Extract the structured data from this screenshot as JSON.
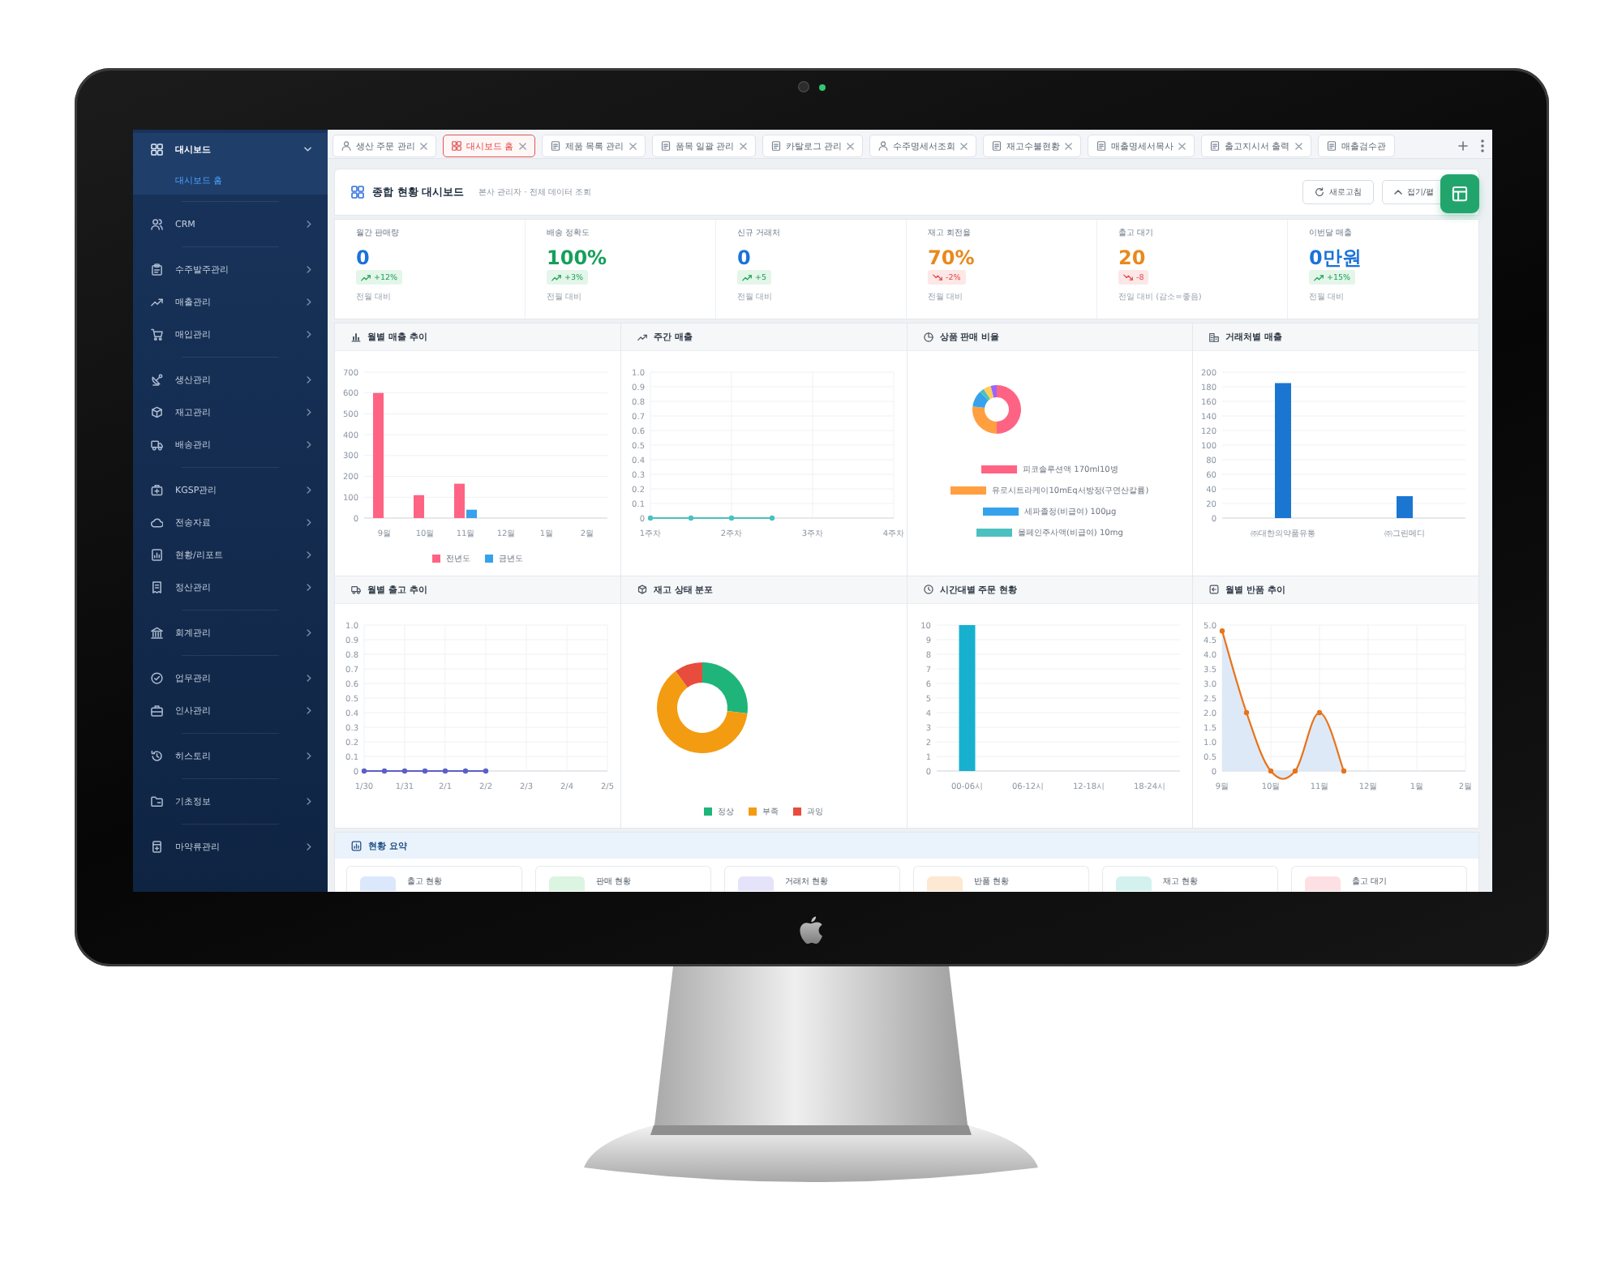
{
  "sidebar": {
    "groups": [
      {
        "items": [
          {
            "label": "대시보드",
            "expanded": true,
            "children": [
              {
                "label": "대시보드 홈",
                "selected": true
              }
            ]
          }
        ]
      },
      {
        "items": [
          {
            "label": "CRM",
            "expanded": false
          }
        ]
      },
      {
        "items": [
          {
            "label": "수주발주관리",
            "expanded": false
          },
          {
            "label": "매출관리",
            "expanded": false
          },
          {
            "label": "매입관리",
            "expanded": false
          }
        ]
      },
      {
        "items": [
          {
            "label": "생산관리",
            "expanded": false
          },
          {
            "label": "재고관리",
            "expanded": false
          },
          {
            "label": "배송관리",
            "expanded": false
          }
        ]
      },
      {
        "items": [
          {
            "label": "KGSP관리",
            "expanded": false
          },
          {
            "label": "전송자료",
            "expanded": false
          },
          {
            "label": "현황/리포트",
            "expanded": false
          },
          {
            "label": "정산관리",
            "expanded": false
          }
        ]
      },
      {
        "items": [
          {
            "label": "회계관리",
            "expanded": false
          }
        ]
      },
      {
        "items": [
          {
            "label": "업무관리",
            "expanded": false
          },
          {
            "label": "인사관리",
            "expanded": false
          }
        ]
      },
      {
        "items": [
          {
            "label": "히스토리",
            "expanded": false
          }
        ]
      },
      {
        "items": [
          {
            "label": "기초정보",
            "expanded": false
          }
        ]
      },
      {
        "items": [
          {
            "label": "마약류관리",
            "expanded": false
          }
        ]
      }
    ]
  },
  "tabs": [
    {
      "label": "생산 주문 관리",
      "selected": false,
      "closable": true
    },
    {
      "label": "대시보드 홈",
      "selected": true,
      "closable": true
    },
    {
      "label": "제품 목록 관리",
      "selected": false,
      "closable": true
    },
    {
      "label": "품목 일괄 관리",
      "selected": false,
      "closable": true
    },
    {
      "label": "카탈로그 관리",
      "selected": false,
      "closable": true
    },
    {
      "label": "수주명세서조회",
      "selected": false,
      "closable": true
    },
    {
      "label": "재고수불현황",
      "selected": false,
      "closable": true
    },
    {
      "label": "매출명세서목사",
      "selected": false,
      "closable": true
    },
    {
      "label": "출고지시서 출력",
      "selected": false,
      "closable": true
    },
    {
      "label": "매출검수관",
      "selected": false,
      "closable": false
    }
  ],
  "header": {
    "title": "종합 현황 대시보드",
    "subtitle": "본사 관리자 · 전체 데이터 조회",
    "buttons": [
      {
        "label": "새로고침",
        "kind": "refresh"
      },
      {
        "label": "접기/펼",
        "kind": "collapse"
      }
    ]
  },
  "kpis": [
    {
      "label": "월간 판매량",
      "value": "0",
      "color": "#1a73d9",
      "change": "+12%",
      "kind": "increase",
      "note": "전월 대비"
    },
    {
      "label": "배송 정확도",
      "value": "100%",
      "color": "#15a05c",
      "change": "+3%",
      "kind": "increase",
      "note": "전월 대비"
    },
    {
      "label": "신규 거래처",
      "value": "0",
      "color": "#1a73d9",
      "change": "+5",
      "kind": "increase",
      "note": "전월 대비"
    },
    {
      "label": "재고 회전율",
      "value": "70%",
      "color": "#e8891c",
      "change": "-2%",
      "kind": "decrease",
      "note": "전월 대비"
    },
    {
      "label": "출고 대기",
      "value": "20",
      "color": "#e8891c",
      "change": "-8",
      "kind": "decrease",
      "note": "전일 대비 (감소=좋음)"
    },
    {
      "label": "이번달 매출",
      "value": "0만원",
      "color": "#1a73d9",
      "change": "+15%",
      "kind": "increase",
      "note": "전월 대비"
    }
  ],
  "charts": [
    {
      "title": "월별 매출 추이",
      "kind": "chart",
      "chart_data": {
        "type": "bar",
        "grid": true,
        "categories": [
          "9월",
          "10월",
          "11월",
          "12월",
          "1월",
          "2월"
        ],
        "series": [
          {
            "name": "전년도",
            "color": "#ff6384",
            "values": [
              600,
              110,
              165,
              0,
              0,
              0
            ]
          },
          {
            "name": "금년도",
            "color": "#36a2eb",
            "values": [
              0,
              0,
              40,
              0,
              0,
              0
            ]
          }
        ],
        "ylim": [
          0,
          700
        ],
        "yticks": [
          {
            "value": 0,
            "label": "0"
          },
          100,
          200,
          300,
          400,
          500,
          600,
          700
        ]
      }
    },
    {
      "title": "주간 매출",
      "kind": "chart",
      "chart_data": {
        "type": "line",
        "grid": true,
        "categories": [
          "1주차",
          null,
          "2주차",
          null,
          "3주차",
          null,
          "4주차"
        ],
        "series": [
          {
            "color": "#4bc0c0",
            "marker": true,
            "values": [
              0,
              0,
              0,
              0,
              null,
              null,
              null
            ]
          }
        ],
        "ylim": [
          0,
          1
        ],
        "yticks": [
          {
            "value": 0,
            "label": "0"
          },
          0.1,
          0.2,
          0.3,
          0.4,
          0.5,
          0.6,
          0.7,
          0.8,
          0.9,
          {
            "value": 1,
            "label": "1.0"
          }
        ]
      }
    },
    {
      "title": "상품 판매 비율",
      "kind": "donut",
      "legend": [
        {
          "label": "피코솔루션액 170ml10병",
          "color": "#ff6384"
        },
        {
          "label": "유로시트라케이10mEq서방정(구연산칼륨)",
          "color": "#ff9f40"
        },
        {
          "label": "세파졸정(비급여) 100µg",
          "color": "#36a2eb"
        },
        {
          "label": "몰페인주사액(비급여) 10mg",
          "color": "#4bc0c0"
        }
      ]
    },
    {
      "title": "거래처별 매출",
      "kind": "chart",
      "chart_data": {
        "type": "bar",
        "grid": true,
        "categories": [
          "㈜대한의약품유통",
          "㈜그린메디"
        ],
        "series": [
          {
            "color": "#1b76d2",
            "values": [
              185,
              30
            ]
          }
        ],
        "ylim": [
          0,
          200
        ],
        "yticks": [
          {
            "value": 0,
            "label": "0"
          },
          {
            "value": 20,
            "label": "20"
          },
          40,
          60,
          80,
          100,
          120,
          140,
          160,
          180,
          200
        ]
      }
    },
    {
      "title": "월별 출고 추이",
      "kind": "chart",
      "chart_data": {
        "type": "line",
        "grid": true,
        "categories": [
          "1/30",
          null,
          "1/31",
          null,
          "2/1",
          null,
          "2/2",
          null,
          "2/3",
          null,
          "2/4",
          null,
          "2/5"
        ],
        "series": [
          {
            "color": "#5b5fc7",
            "marker": true,
            "values": [
              0,
              0,
              0,
              0,
              0,
              0,
              0,
              null,
              null,
              null,
              null,
              null,
              null
            ]
          }
        ],
        "ylim": [
          0,
          1
        ],
        "yticks": [
          {
            "value": 0,
            "label": "0"
          },
          0.1,
          0.2,
          0.3,
          0.4,
          0.5,
          0.6,
          0.7,
          0.8,
          0.9,
          {
            "value": 1,
            "label": "1.0"
          }
        ]
      }
    },
    {
      "title": "재고 상태 분포",
      "kind": "donut",
      "legend": [
        {
          "label": "정상",
          "color": "#1fb57a"
        },
        {
          "label": "부족",
          "color": "#f39c12"
        },
        {
          "label": "과잉",
          "color": "#e74c3c"
        }
      ]
    },
    {
      "title": "시간대별 주문 현황",
      "kind": "chart",
      "chart_data": {
        "type": "bar",
        "grid": true,
        "categories": [
          "00-06시",
          "06-12시",
          "12-18시",
          "18-24시"
        ],
        "series": [
          {
            "color": "#17b1cf",
            "values": [
              10,
              0,
              0,
              0
            ]
          }
        ],
        "ylim": [
          0,
          10
        ],
        "yticks": [
          {
            "value": 0,
            "label": "0"
          },
          1,
          2,
          3,
          4,
          5,
          6,
          7,
          8,
          9,
          10
        ]
      }
    },
    {
      "title": "월별 반품 추이",
      "kind": "chart",
      "chart_data": {
        "type": "area",
        "grid": true,
        "categories": [
          "9월",
          null,
          "10월",
          null,
          "11월",
          null,
          "12월",
          null,
          "1월",
          null,
          "2월"
        ],
        "series": [
          {
            "color": "#e8731a",
            "marker": true,
            "values": [
              4.8,
              2,
              0,
              0,
              2,
              0,
              null,
              null,
              null,
              null,
              null
            ]
          }
        ],
        "ylim": [
          0,
          5
        ],
        "yticks": [
          {
            "value": 0,
            "label": "0"
          },
          0.5,
          {
            "value": 1,
            "label": "1.0"
          },
          1.5,
          {
            "value": 2,
            "label": "2.0"
          },
          2.5,
          {
            "value": 3,
            "label": "3.0"
          },
          3.5,
          {
            "value": 4,
            "label": "4.0"
          },
          4.5,
          {
            "value": 5,
            "label": "5.0"
          }
        ]
      }
    }
  ],
  "summary": {
    "title": "현황 요약",
    "cards": [
      {
        "label": "출고 현황",
        "color": "#dbe7fb"
      },
      {
        "label": "판매 현황",
        "color": "#dcf4e2"
      },
      {
        "label": "거래처 현황",
        "color": "#e5e3fa"
      },
      {
        "label": "반품 현황",
        "color": "#fde8d2"
      },
      {
        "label": "재고 현황",
        "color": "#d3f2ef"
      },
      {
        "label": "출고 대기",
        "color": "#fde0e3"
      }
    ]
  }
}
